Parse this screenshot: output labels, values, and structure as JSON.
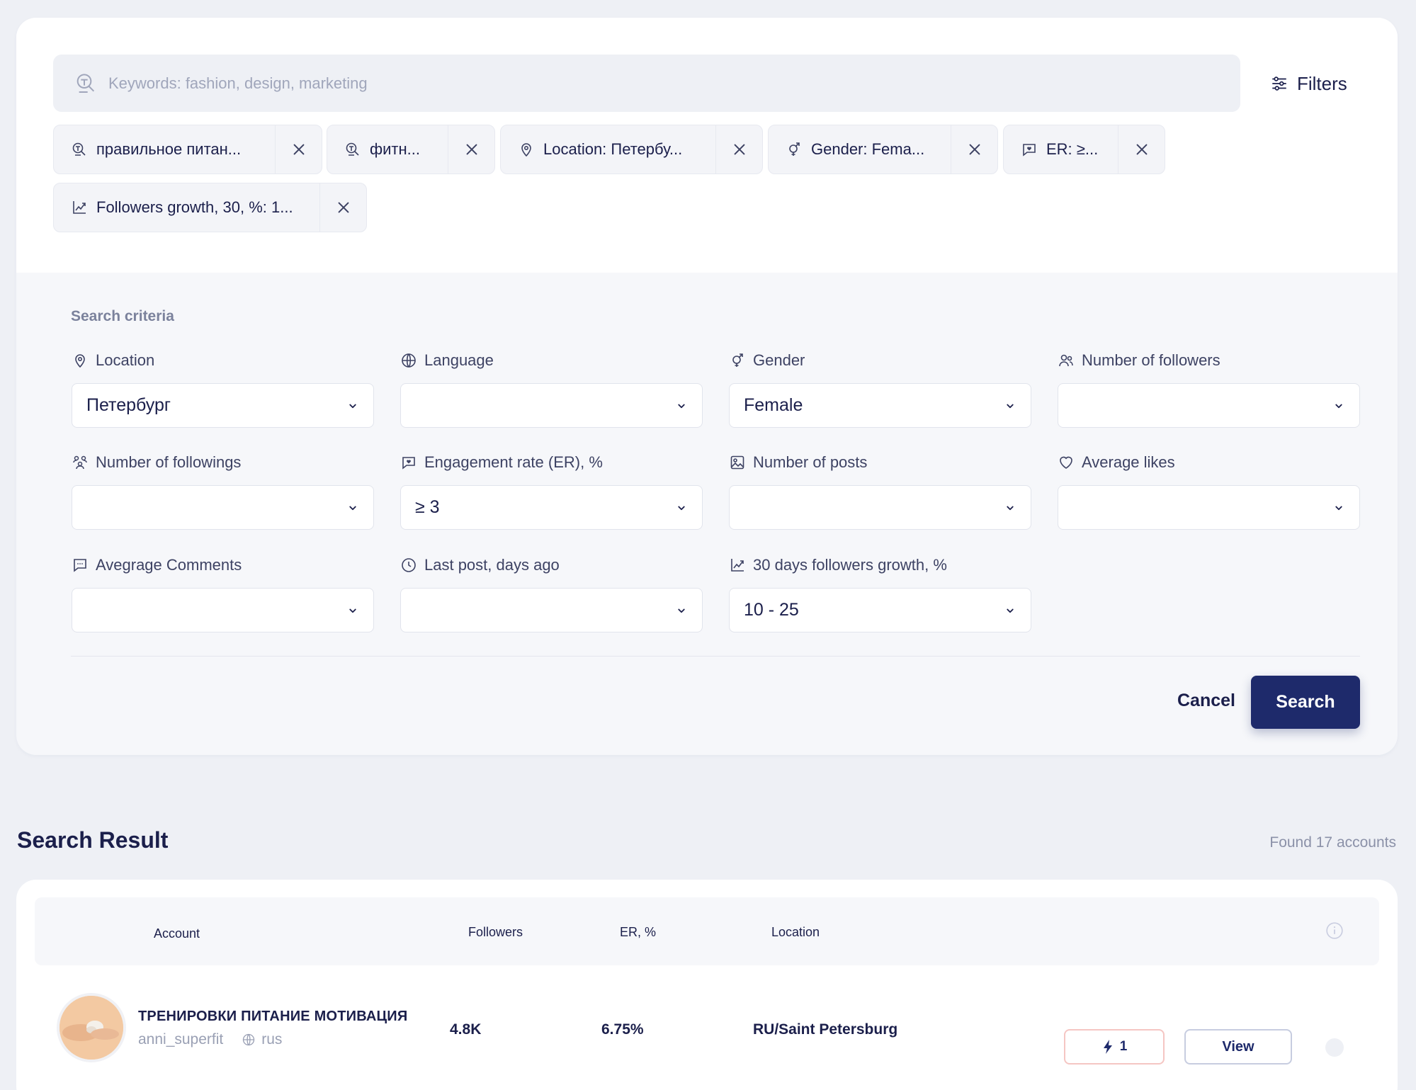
{
  "search": {
    "placeholder": "Keywords: fashion, design, marketing"
  },
  "filters_label": "Filters",
  "chips": [
    {
      "icon": "keyword-icon",
      "label": "правильное питан..."
    },
    {
      "icon": "keyword-icon",
      "label": "фитн..."
    },
    {
      "icon": "location-pin-icon",
      "label": "Location: Петербу..."
    },
    {
      "icon": "gender-icon",
      "label": "Gender: Fema..."
    },
    {
      "icon": "engagement-icon",
      "label": "ER: ≥..."
    },
    {
      "icon": "growth-chart-icon",
      "label": "Followers growth, 30, %: 1..."
    }
  ],
  "criteria": {
    "title": "Search criteria",
    "fields": [
      {
        "label": "Location",
        "value": "Петербург",
        "icon": "location-pin-icon"
      },
      {
        "label": "Language",
        "value": "",
        "icon": "globe-icon"
      },
      {
        "label": "Gender",
        "value": "Female",
        "icon": "gender-icon"
      },
      {
        "label": "Number of followers",
        "value": "",
        "icon": "users-icon"
      },
      {
        "label": "Number of followings",
        "value": "",
        "icon": "followings-icon"
      },
      {
        "label": "Engagement rate (ER), %",
        "value": "≥ 3",
        "icon": "engagement-icon"
      },
      {
        "label": "Number of posts",
        "value": "",
        "icon": "image-icon"
      },
      {
        "label": "Average likes",
        "value": "",
        "icon": "heart-icon"
      },
      {
        "label": "Avegrage Comments",
        "value": "",
        "icon": "comment-icon"
      },
      {
        "label": "Last post, days ago",
        "value": "",
        "icon": "clock-icon"
      },
      {
        "label": "30 days followers growth, %",
        "value": "10 - 25",
        "icon": "growth-chart-icon"
      }
    ],
    "cancel_label": "Cancel",
    "search_label": "Search"
  },
  "results": {
    "title": "Search Result",
    "found": "Found 17 accounts",
    "columns": {
      "account": "Account",
      "followers": "Followers",
      "er": "ER, %",
      "location": "Location"
    },
    "rows": [
      {
        "name": "ТРЕНИРОВКИ ПИТАНИЕ МОТИВАЦИЯ",
        "username": "anni_superfit",
        "language": "rus",
        "followers": "4.8K",
        "er": "6.75%",
        "location": "RU/Saint Petersburg",
        "boost_count": "1",
        "view_label": "View"
      }
    ]
  },
  "colors": {
    "primary": "#1e2a6b",
    "text": "#1b1f4b",
    "muted": "#8b91a8",
    "boost_border": "#f5c6c3"
  }
}
